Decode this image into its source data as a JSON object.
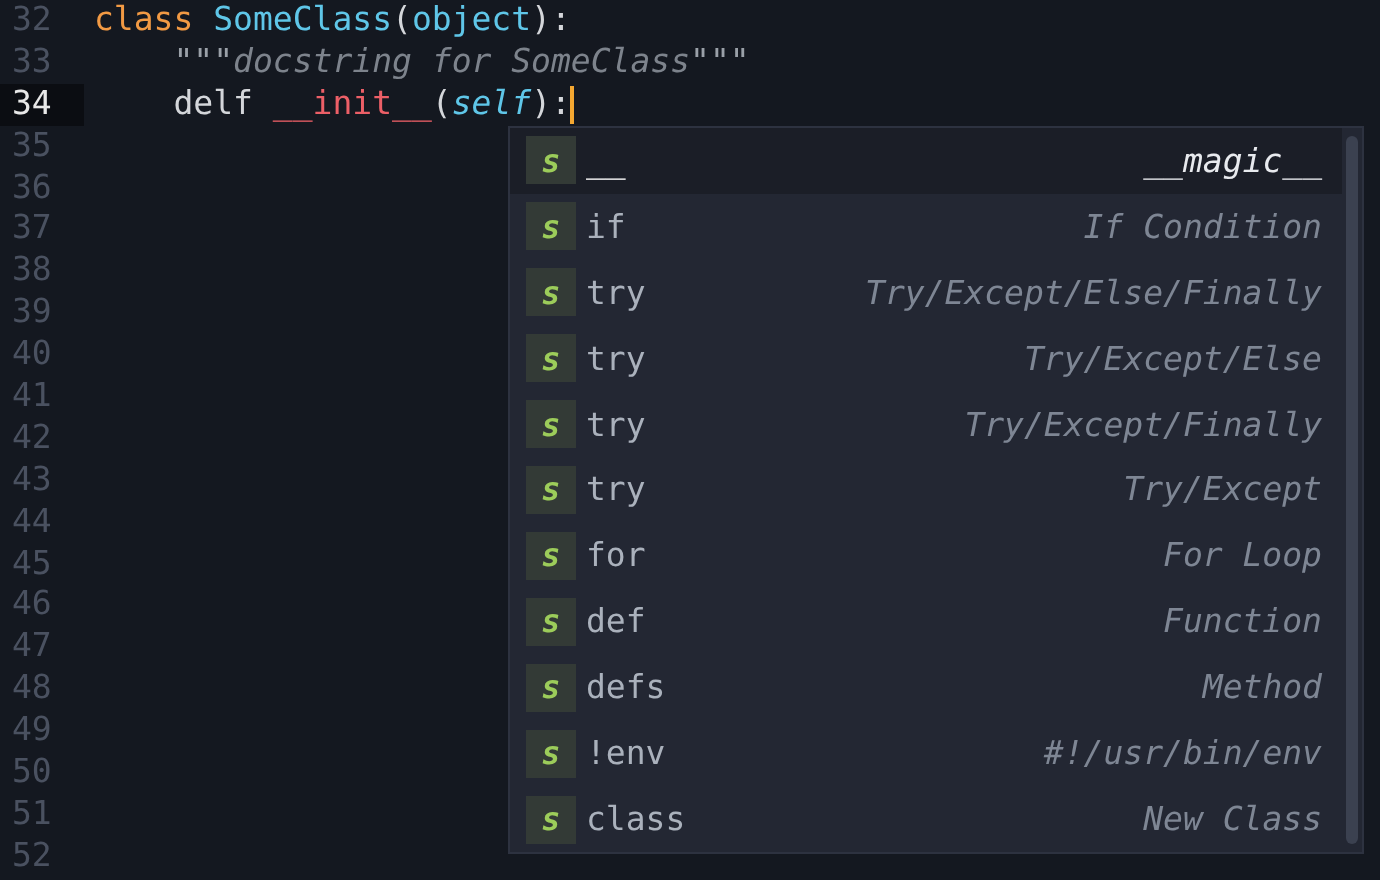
{
  "editor": {
    "lines": [
      {
        "number": "32",
        "current": false,
        "indent": false,
        "tokens": [
          {
            "kind": "keyword",
            "text": "class",
            "spaced": false
          },
          {
            "kind": "type",
            "text": "SomeClass",
            "spaced": true
          },
          {
            "kind": "plain",
            "text": "(",
            "spaced": false
          },
          {
            "kind": "type",
            "text": "object",
            "spaced": false
          },
          {
            "kind": "plain",
            "text": "):",
            "spaced": false
          }
        ]
      },
      {
        "number": "33",
        "current": false,
        "indent": true,
        "tokens": [
          {
            "kind": "quote",
            "text": "\"\"\"",
            "spaced": false
          },
          {
            "kind": "string",
            "text": "docstring for SomeClass",
            "spaced": false
          },
          {
            "kind": "quote",
            "text": "\"\"\"",
            "spaced": false
          }
        ]
      },
      {
        "number": "34",
        "current": true,
        "indent": true,
        "tokens": [
          {
            "kind": "plain",
            "text": "delf",
            "spaced": false
          },
          {
            "kind": "magic",
            "text": "__init__",
            "spaced": true
          },
          {
            "kind": "plain",
            "text": "(",
            "spaced": false
          },
          {
            "kind": "param",
            "text": "self",
            "spaced": false
          },
          {
            "kind": "plain",
            "text": "):",
            "spaced": false
          }
        ]
      },
      {
        "number": "35",
        "current": false
      },
      {
        "number": "36",
        "current": false
      },
      {
        "number": "37",
        "current": false
      },
      {
        "number": "38",
        "current": false
      },
      {
        "number": "39",
        "current": false
      },
      {
        "number": "40",
        "current": false
      },
      {
        "number": "41",
        "current": false
      },
      {
        "number": "42",
        "current": false
      },
      {
        "number": "43",
        "current": false
      },
      {
        "number": "44",
        "current": false
      },
      {
        "number": "45",
        "current": false
      },
      {
        "number": "46",
        "current": false
      },
      {
        "number": "47",
        "current": false
      },
      {
        "number": "48",
        "current": false
      },
      {
        "number": "49",
        "current": false
      },
      {
        "number": "50",
        "current": false
      },
      {
        "number": "51",
        "current": false
      },
      {
        "number": "52",
        "current": false
      }
    ]
  },
  "completions": [
    {
      "badge": "s",
      "trigger": "__",
      "description": "__magic__",
      "selected": true
    },
    {
      "badge": "s",
      "trigger": "if",
      "description": "If Condition",
      "selected": false
    },
    {
      "badge": "s",
      "trigger": "try",
      "description": "Try/Except/Else/Finally",
      "selected": false
    },
    {
      "badge": "s",
      "trigger": "try",
      "description": "Try/Except/Else",
      "selected": false
    },
    {
      "badge": "s",
      "trigger": "try",
      "description": "Try/Except/Finally",
      "selected": false
    },
    {
      "badge": "s",
      "trigger": "try",
      "description": "Try/Except",
      "selected": false
    },
    {
      "badge": "s",
      "trigger": "for",
      "description": "For Loop",
      "selected": false
    },
    {
      "badge": "s",
      "trigger": "def",
      "description": "Function",
      "selected": false
    },
    {
      "badge": "s",
      "trigger": "defs",
      "description": "Method",
      "selected": false
    },
    {
      "badge": "s",
      "trigger": "!env",
      "description": "#!/usr/bin/env",
      "selected": false
    },
    {
      "badge": "s",
      "trigger": "class",
      "description": "New Class",
      "selected": false
    }
  ]
}
